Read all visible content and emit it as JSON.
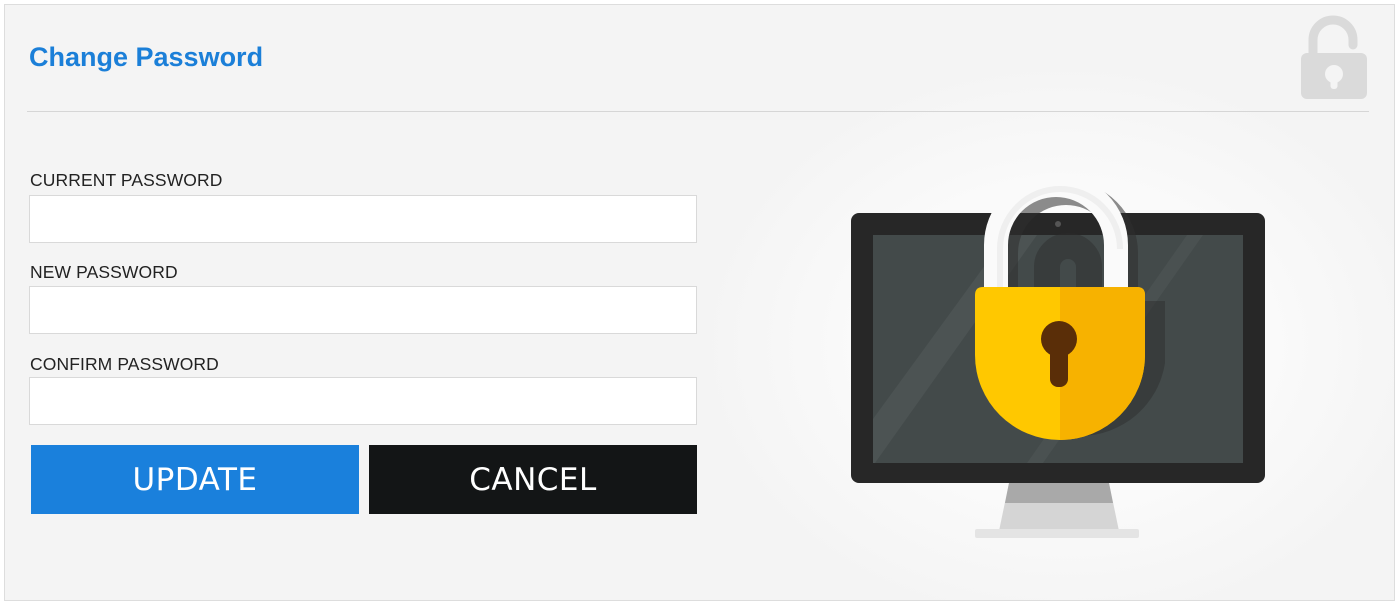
{
  "page": {
    "title": "Change Password"
  },
  "form": {
    "current_password": {
      "label": "CURRENT PASSWORD",
      "value": "",
      "placeholder": ""
    },
    "new_password": {
      "label": "NEW PASSWORD",
      "value": "",
      "placeholder": ""
    },
    "confirm_password": {
      "label": "CONFIRM PASSWORD",
      "value": "",
      "placeholder": ""
    }
  },
  "buttons": {
    "update_label": "UPDATE",
    "cancel_label": "CANCEL"
  },
  "icons": {
    "header": "unlocked-padlock-icon",
    "illustration": "monitor-with-padlock-icon"
  },
  "colors": {
    "accent": "#1b7fd8",
    "update_button": "#1a80dc",
    "cancel_button": "#131516",
    "padlock_body": "#ffc107"
  }
}
